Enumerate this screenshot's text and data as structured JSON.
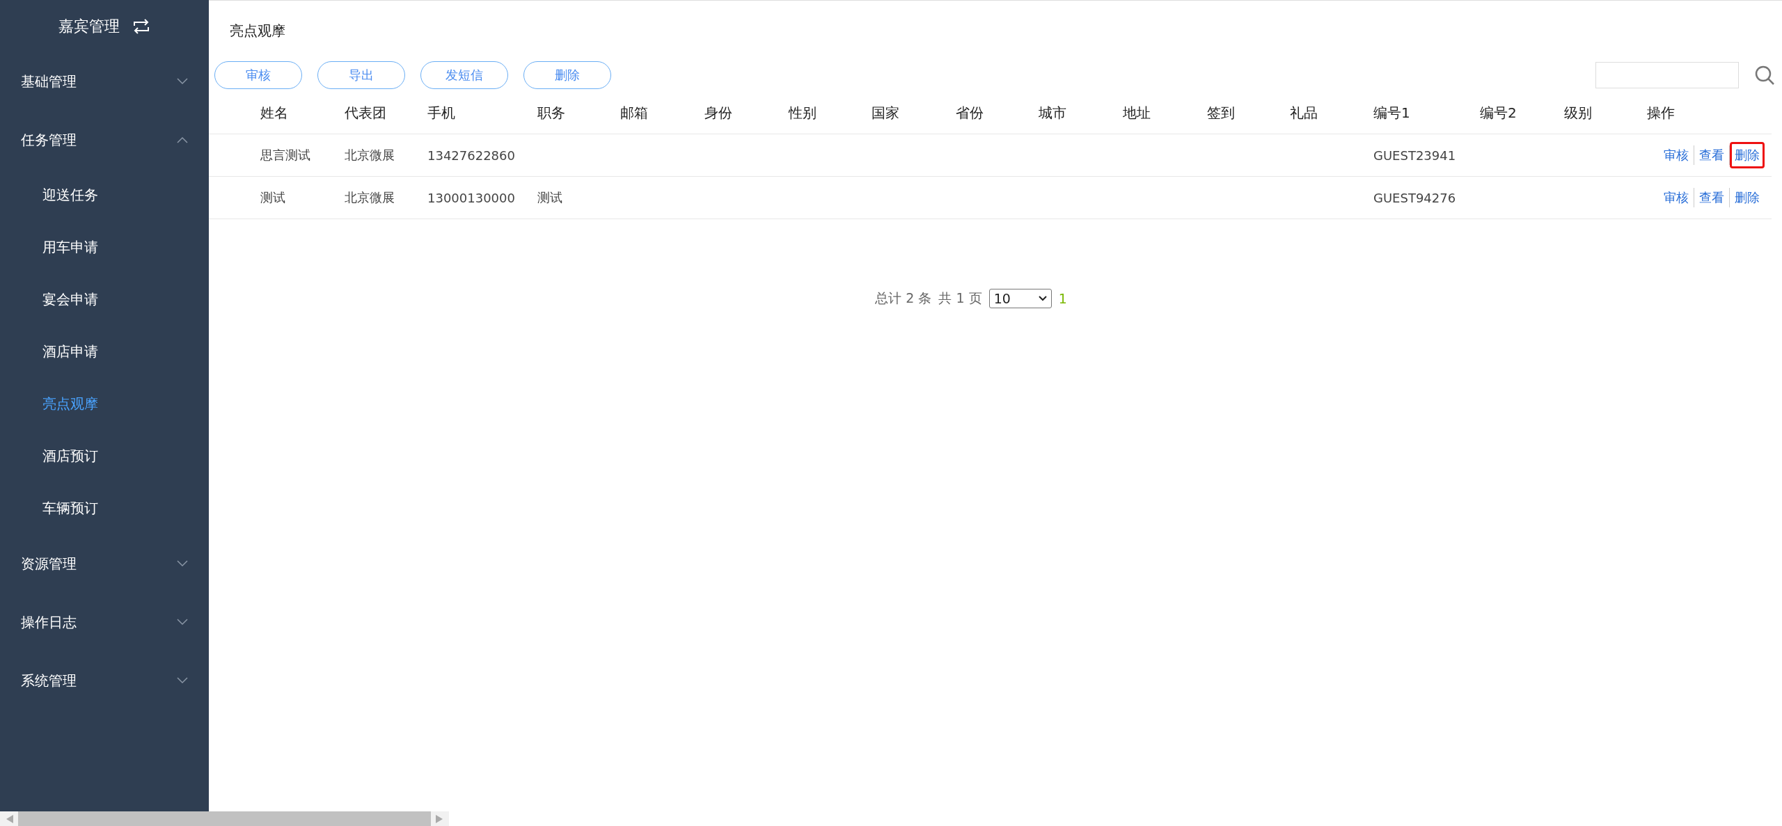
{
  "sidebar": {
    "title": "嘉宾管理",
    "groups": [
      {
        "label": "基础管理",
        "expanded": false
      },
      {
        "label": "任务管理",
        "expanded": true,
        "children": [
          {
            "label": "迎送任务",
            "selected": false
          },
          {
            "label": "用车申请",
            "selected": false
          },
          {
            "label": "宴会申请",
            "selected": false
          },
          {
            "label": "酒店申请",
            "selected": false
          },
          {
            "label": "亮点观摩",
            "selected": true
          },
          {
            "label": "酒店预订",
            "selected": false
          },
          {
            "label": "车辆预订",
            "selected": false
          }
        ]
      },
      {
        "label": "资源管理",
        "expanded": false
      },
      {
        "label": "操作日志",
        "expanded": false
      },
      {
        "label": "系统管理",
        "expanded": false
      }
    ]
  },
  "page_title": "亮点观摩",
  "toolbar": {
    "buttons": [
      "审核",
      "导出",
      "发短信",
      "删除"
    ]
  },
  "table": {
    "columns": [
      "姓名",
      "代表团",
      "手机",
      "职务",
      "邮箱",
      "身份",
      "性别",
      "国家",
      "省份",
      "城市",
      "地址",
      "签到",
      "礼品",
      "编号1",
      "编号2",
      "级别",
      "操作"
    ],
    "rows": [
      {
        "cells": [
          "思言测试",
          "北京微展",
          "13427622860",
          "",
          "",
          "",
          "",
          "",
          "",
          "",
          "",
          "",
          "",
          "GUEST23941",
          "",
          ""
        ],
        "actions": [
          {
            "label": "审核",
            "highlighted": false
          },
          {
            "label": "查看",
            "highlighted": false
          },
          {
            "label": "删除",
            "highlighted": true
          }
        ]
      },
      {
        "cells": [
          "测试",
          "北京微展",
          "13000130000",
          "测试",
          "",
          "",
          "",
          "",
          "",
          "",
          "",
          "",
          "",
          "GUEST94276",
          "",
          ""
        ],
        "actions": [
          {
            "label": "审核",
            "highlighted": false
          },
          {
            "label": "查看",
            "highlighted": false
          },
          {
            "label": "删除",
            "highlighted": false
          }
        ]
      }
    ]
  },
  "pagination": {
    "total": "总计 2 条",
    "pages": "共 1 页",
    "page_size": "10",
    "current": "1"
  }
}
